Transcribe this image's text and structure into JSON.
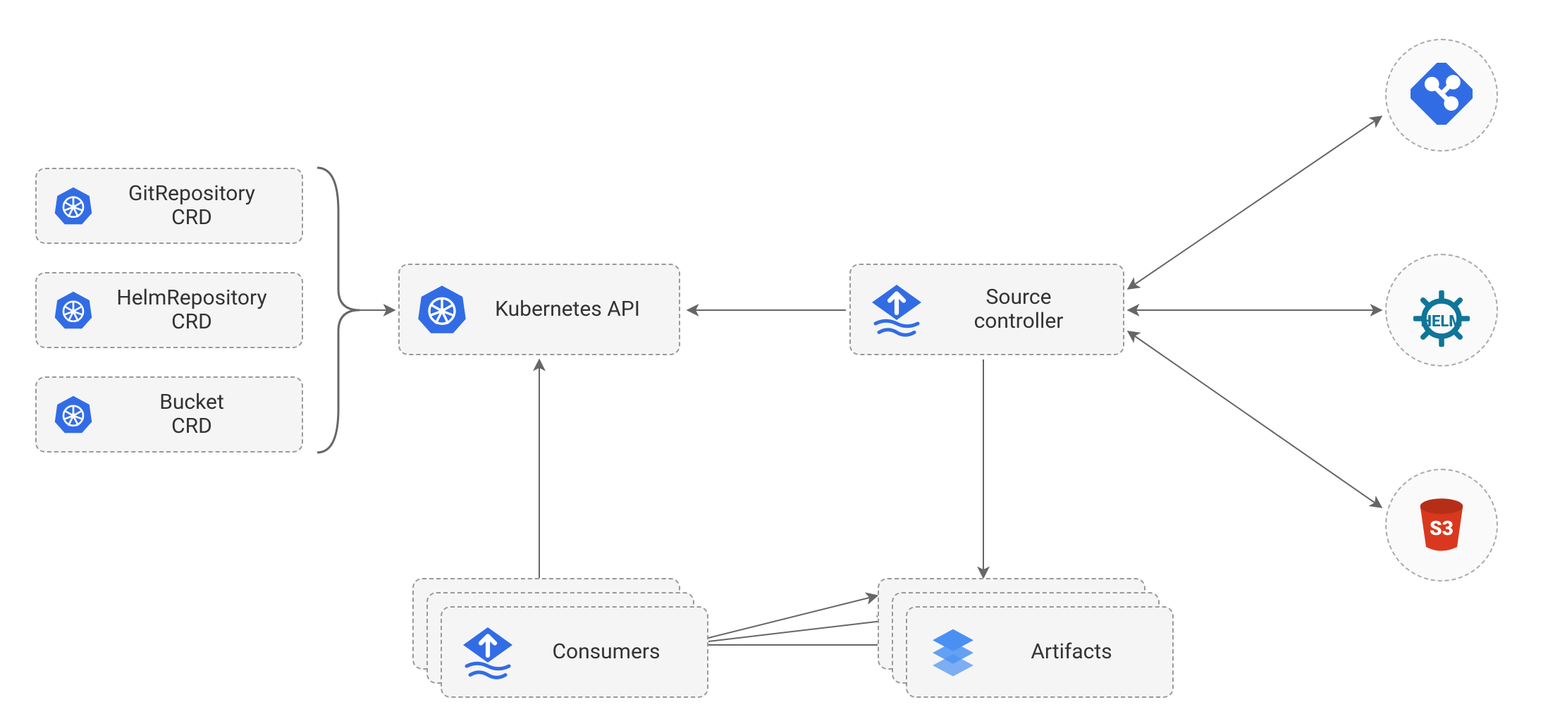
{
  "crds": {
    "git": {
      "line1": "GitRepository",
      "line2": "CRD"
    },
    "helm": {
      "line1": "HelmRepository",
      "line2": "CRD"
    },
    "bucket": {
      "line1": "Bucket",
      "line2": "CRD"
    }
  },
  "k8s_api": {
    "label": "Kubernetes API"
  },
  "source_ctl": {
    "line1": "Source",
    "line2": "controller"
  },
  "consumers": {
    "label": "Consumers"
  },
  "artifacts": {
    "label": "Artifacts"
  },
  "externals": {
    "git": {
      "name": "git"
    },
    "helm": {
      "name": "HELM"
    },
    "s3": {
      "name": "S3"
    }
  },
  "colors": {
    "k8s_blue": "#326ce5",
    "helm_teal": "#0f7599",
    "s3_red": "#d9381e",
    "line": "#666666"
  }
}
